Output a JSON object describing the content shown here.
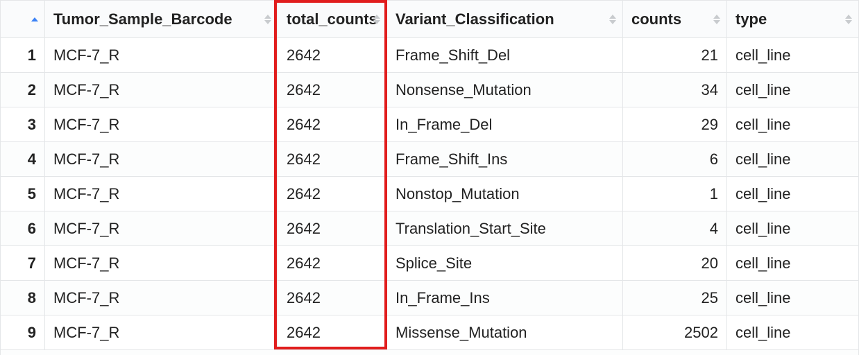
{
  "table": {
    "headers": {
      "idx": "",
      "tsb": "Tumor_Sample_Barcode",
      "tot": "total_counts",
      "vc": "Variant_Classification",
      "cnt": "counts",
      "type": "type"
    },
    "rows": [
      {
        "idx": "1",
        "tsb": "MCF-7_R",
        "tot": "2642",
        "vc": "Frame_Shift_Del",
        "cnt": "21",
        "type": "cell_line"
      },
      {
        "idx": "2",
        "tsb": "MCF-7_R",
        "tot": "2642",
        "vc": "Nonsense_Mutation",
        "cnt": "34",
        "type": "cell_line"
      },
      {
        "idx": "3",
        "tsb": "MCF-7_R",
        "tot": "2642",
        "vc": "In_Frame_Del",
        "cnt": "29",
        "type": "cell_line"
      },
      {
        "idx": "4",
        "tsb": "MCF-7_R",
        "tot": "2642",
        "vc": "Frame_Shift_Ins",
        "cnt": "6",
        "type": "cell_line"
      },
      {
        "idx": "5",
        "tsb": "MCF-7_R",
        "tot": "2642",
        "vc": "Nonstop_Mutation",
        "cnt": "1",
        "type": "cell_line"
      },
      {
        "idx": "6",
        "tsb": "MCF-7_R",
        "tot": "2642",
        "vc": "Translation_Start_Site",
        "cnt": "4",
        "type": "cell_line"
      },
      {
        "idx": "7",
        "tsb": "MCF-7_R",
        "tot": "2642",
        "vc": "Splice_Site",
        "cnt": "20",
        "type": "cell_line"
      },
      {
        "idx": "8",
        "tsb": "MCF-7_R",
        "tot": "2642",
        "vc": "In_Frame_Ins",
        "cnt": "25",
        "type": "cell_line"
      },
      {
        "idx": "9",
        "tsb": "MCF-7_R",
        "tot": "2642",
        "vc": "Missense_Mutation",
        "cnt": "2502",
        "type": "cell_line"
      }
    ]
  }
}
